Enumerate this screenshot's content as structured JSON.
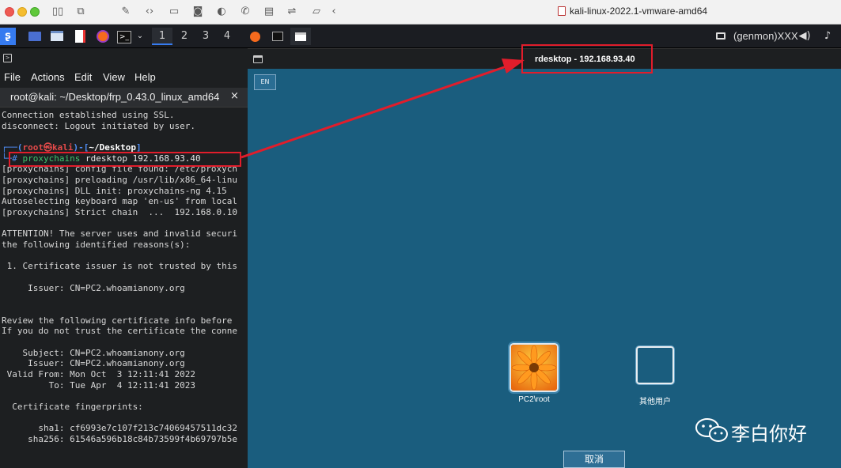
{
  "window": {
    "title": "kali-linux-2022.1-vmware-amd64"
  },
  "taskbar": {
    "workspaces": [
      "1",
      "2",
      "3",
      "4"
    ],
    "status_text": "(genmon)XXX"
  },
  "terminal": {
    "menu": [
      "File",
      "Actions",
      "Edit",
      "View",
      "Help"
    ],
    "tab_title": "root@kali: ~/Desktop/frp_0.43.0_linux_amd64",
    "tab_close": "×",
    "lines": [
      "Connection established using SSL.",
      "disconnect: Logout initiated by user.",
      "",
      "┌──(root㉿kali)-[~/Desktop]",
      "└─# proxychains rdesktop 192.168.93.40",
      "[proxychains] config file found: /etc/proxych",
      "[proxychains] preloading /usr/lib/x86_64-linu",
      "[proxychains] DLL init: proxychains-ng 4.15",
      "Autoselecting keyboard map 'en-us' from local",
      "[proxychains] Strict chain  ...  192.168.0.10",
      "",
      "ATTENTION! The server uses and invalid securi",
      "the following identified reasons(s):",
      "",
      " 1. Certificate issuer is not trusted by this",
      "",
      "     Issuer: CN=PC2.whoamianony.org",
      "",
      "",
      "Review the following certificate info before",
      "If you do not trust the certificate the conne",
      "",
      "    Subject: CN=PC2.whoamianony.org",
      "     Issuer: CN=PC2.whoamianony.org",
      " Valid From: Mon Oct  3 12:11:41 2022",
      "         To: Tue Apr  4 12:11:41 2023",
      "",
      "  Certificate fingerprints:",
      "",
      "       sha1: cf6993e7c107f213c74069457511dc32",
      "     sha256: 61546a596b18c84b73599f4b69797b5e"
    ]
  },
  "rdp": {
    "title": "rdesktop - 192.168.93.40",
    "lang": "EN",
    "users": [
      {
        "name": "PC2\\root"
      },
      {
        "name": "其他用户"
      }
    ],
    "cancel": "取消"
  },
  "watermark": {
    "text": "李白你好"
  },
  "colors": {
    "annotation": "#e11d2b",
    "desktop": "#1a5d7e"
  }
}
